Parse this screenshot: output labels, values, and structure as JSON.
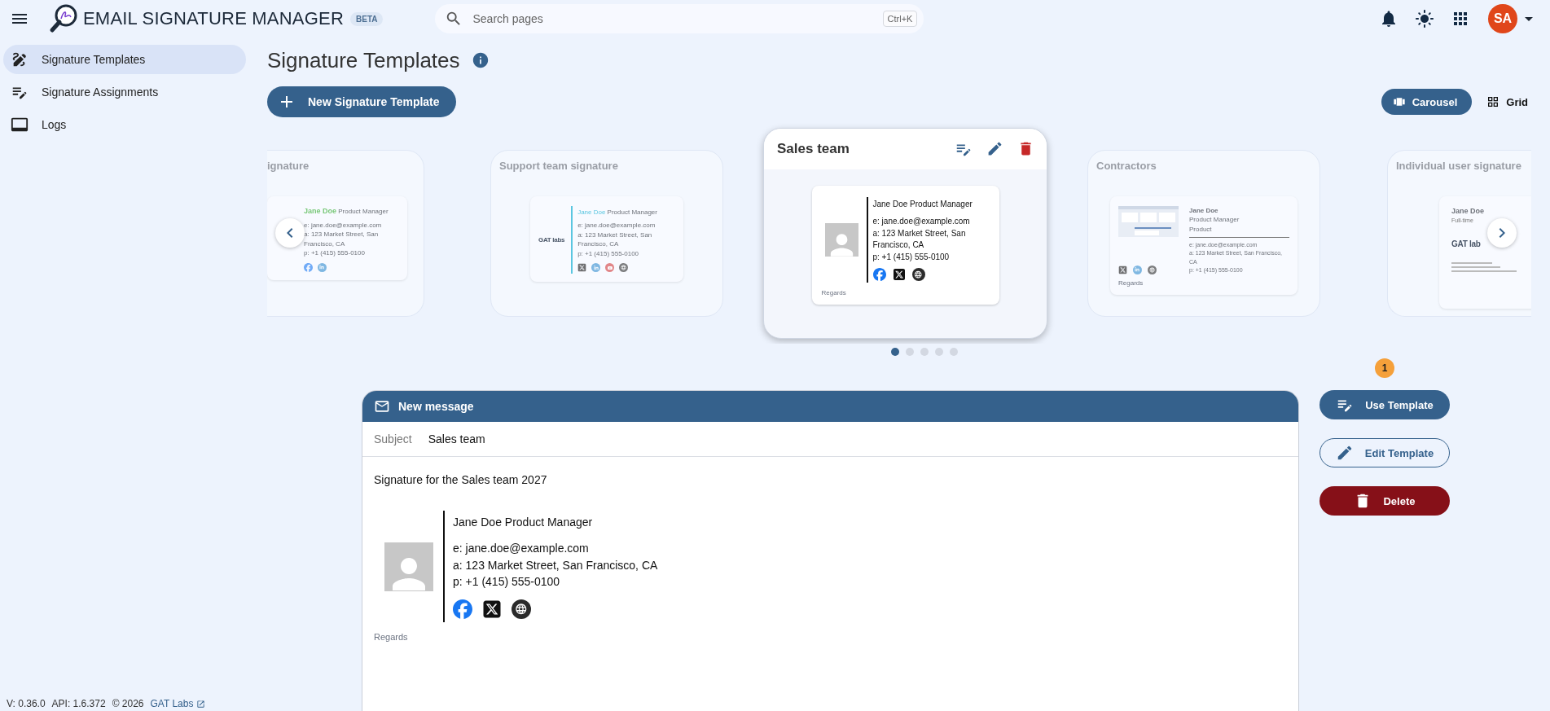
{
  "app": {
    "title": "EMAIL SIGNATURE MANAGER",
    "badge": "BETA"
  },
  "search": {
    "placeholder": "Search pages",
    "shortcut": "Ctrl+K"
  },
  "user": {
    "initials": "SA"
  },
  "sidebar": {
    "items": [
      {
        "label": "Signature Templates",
        "selected": true
      },
      {
        "label": "Signature Assignments",
        "selected": false
      },
      {
        "label": "Logs",
        "selected": false
      }
    ]
  },
  "footer": {
    "version": "V: 0.36.0",
    "api": "API: 1.6.372",
    "copyright": "© 2026",
    "link": "GAT Labs"
  },
  "page": {
    "title": "Signature Templates",
    "new_button": "New Signature Template"
  },
  "view_toggle": [
    {
      "label": "Carousel",
      "selected": true
    },
    {
      "label": "Grid",
      "selected": false
    }
  ],
  "carousel": {
    "cards": [
      {
        "title": "ignature",
        "selected": false,
        "kind": "plain",
        "name": "Jane Doe",
        "role": "Product Manager",
        "color": "#79c879",
        "lines": [
          "e: jane.doe@example.com",
          "a: 123 Market Street, San Francisco, CA",
          "p: +1 (415) 555-0100"
        ],
        "socials": [
          {
            "kind": "facebook"
          },
          {
            "kind": "linkedin"
          }
        ]
      },
      {
        "title": "Support team signature",
        "selected": false,
        "kind": "logo",
        "logo": "GAT labs",
        "name": "Jane Doe",
        "role": "Product Manager",
        "color": "#5bc6e0",
        "lines": [
          "e: jane.doe@example.com",
          "a: 123 Market Street, San Francisco, CA",
          "p: +1 (415) 555-0100"
        ],
        "socials": [
          {
            "kind": "x"
          },
          {
            "kind": "linkedin"
          },
          {
            "kind": "youtube"
          },
          {
            "kind": "www"
          }
        ]
      },
      {
        "title": "Sales team",
        "selected": true,
        "name": "Jane Doe",
        "role": "Product Manager",
        "lines": [
          "e: jane.doe@example.com",
          "a: 123 Market Street, San Francisco, CA",
          "p: +1 (415) 555-0100"
        ],
        "socials": [
          {
            "kind": "facebook"
          },
          {
            "kind": "x"
          },
          {
            "kind": "www"
          }
        ],
        "closing": "Regards"
      },
      {
        "title": "Contractors",
        "selected": false,
        "kind": "screenshot",
        "name": "Jane Doe",
        "role": "Product Manager",
        "department": "Product",
        "lines": [
          "e: jane.doe@example.com",
          "a: 123 Market Street, San Francisco, CA",
          "p: +1 (415) 555-0100"
        ],
        "socials": [
          {
            "kind": "x"
          },
          {
            "kind": "linkedin"
          },
          {
            "kind": "www"
          }
        ],
        "closing": "Regards"
      },
      {
        "title": "Individual user signature",
        "selected": false,
        "kind": "stacked",
        "name": "Jane Doe",
        "role": "Full-time",
        "logo": "GAT lab"
      }
    ],
    "dots": [
      {
        "selected": true
      },
      {
        "selected": false
      },
      {
        "selected": false
      },
      {
        "selected": false
      },
      {
        "selected": false
      }
    ]
  },
  "compose": {
    "title": "New message",
    "subject_label": "Subject",
    "subject": "Sales team",
    "body": "Signature for the Sales team 2027",
    "signature": {
      "name": "Jane Doe",
      "role": "Product Manager",
      "lines": [
        "e: jane.doe@example.com",
        "a: 123 Market Street, San Francisco, CA",
        "p: +1 (415) 555-0100"
      ],
      "socials": [
        {
          "kind": "facebook"
        },
        {
          "kind": "x"
        },
        {
          "kind": "www"
        }
      ],
      "closing": "Regards"
    }
  },
  "actions": [
    {
      "label": "Use Template",
      "kind": "primary",
      "badge": "1"
    },
    {
      "label": "Edit Template",
      "kind": "outline"
    },
    {
      "label": "Delete",
      "kind": "danger"
    }
  ]
}
